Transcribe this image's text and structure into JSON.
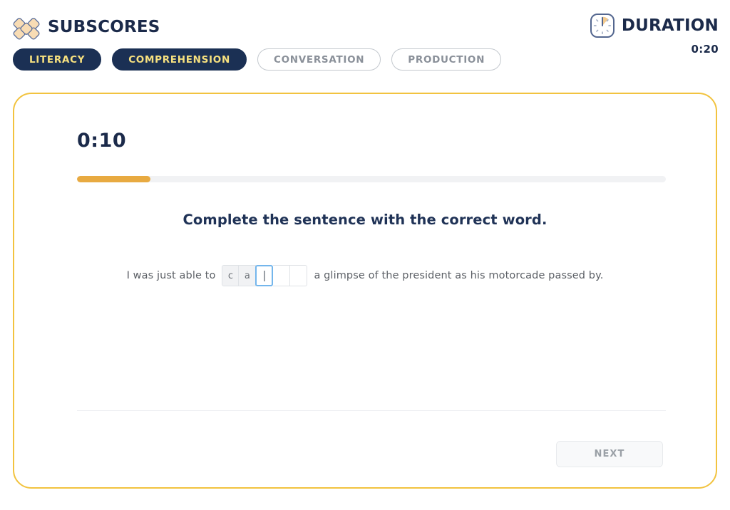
{
  "header": {
    "brand_title": "SUBSCORES",
    "logo_icon": "four-diamond-cluster-icon",
    "duration_label": "DURATION",
    "duration_value": "0:20",
    "duration_icon": "clock-icon"
  },
  "tabs": [
    {
      "label": "LITERACY",
      "state": "active"
    },
    {
      "label": "COMPREHENSION",
      "state": "active"
    },
    {
      "label": "CONVERSATION",
      "state": "inactive"
    },
    {
      "label": "PRODUCTION",
      "state": "inactive"
    }
  ],
  "card": {
    "timer": "0:10",
    "progress_percent": 12.5,
    "question_heading": "Complete the sentence with the correct word.",
    "sentence": {
      "before": "I was just able to",
      "after": "a glimpse of the president as his motorcade passed by."
    },
    "letter_boxes": [
      {
        "value": "c",
        "state": "filled"
      },
      {
        "value": "a",
        "state": "filled"
      },
      {
        "value": "",
        "state": "focused"
      },
      {
        "value": "",
        "state": "empty"
      },
      {
        "value": "",
        "state": "empty"
      }
    ],
    "next_label": "NEXT"
  },
  "colors": {
    "navy": "#1b3054",
    "yellow_text": "#f7e17f",
    "card_border": "#f2c33f",
    "progress_fill": "#e8aa41",
    "focus_blue": "#74b6ec",
    "muted_gray": "#8a9099"
  }
}
